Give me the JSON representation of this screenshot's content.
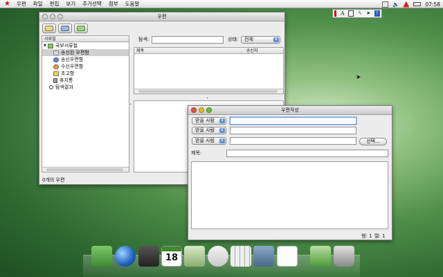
{
  "menubar": {
    "items": [
      "우편",
      "파일",
      "편집",
      "보기",
      "추가선택",
      "첨부",
      "도움말"
    ],
    "clock": "07:58"
  },
  "mail_window": {
    "title": "우편",
    "tree_header": "서류철",
    "tree": [
      "국부서류철",
      "송신된 우편함",
      "송신우편함",
      "수신우편함",
      "초고함",
      "휴지통",
      "탐색결과"
    ],
    "search_label": "탐색:",
    "search_value": "",
    "state_label": "상태:",
    "state_value": "전체",
    "col_subject": "제목",
    "col_sender": "송신자",
    "status": "0개의 우편"
  },
  "compose_window": {
    "title": "우편작성",
    "recipient_type": "받을 사람",
    "recipients": [
      "",
      "",
      ""
    ],
    "select_button": "선택...",
    "subject_label": "제목:",
    "subject_value": "",
    "body": "",
    "line_status": "행: 1",
    "col_status": "렬: 1"
  },
  "dock": {
    "icons": [
      "address-book-icon",
      "globe-icon",
      "video-icon",
      "calendar-icon",
      "contacts-icon",
      "image-viewer-icon",
      "calculator-icon",
      "tools-icon",
      "mail-icon",
      "system-icon",
      "trash-icon"
    ],
    "calendar_day": "18"
  },
  "colors": {
    "star": "#d01010",
    "accent": "#5b8fd6"
  }
}
